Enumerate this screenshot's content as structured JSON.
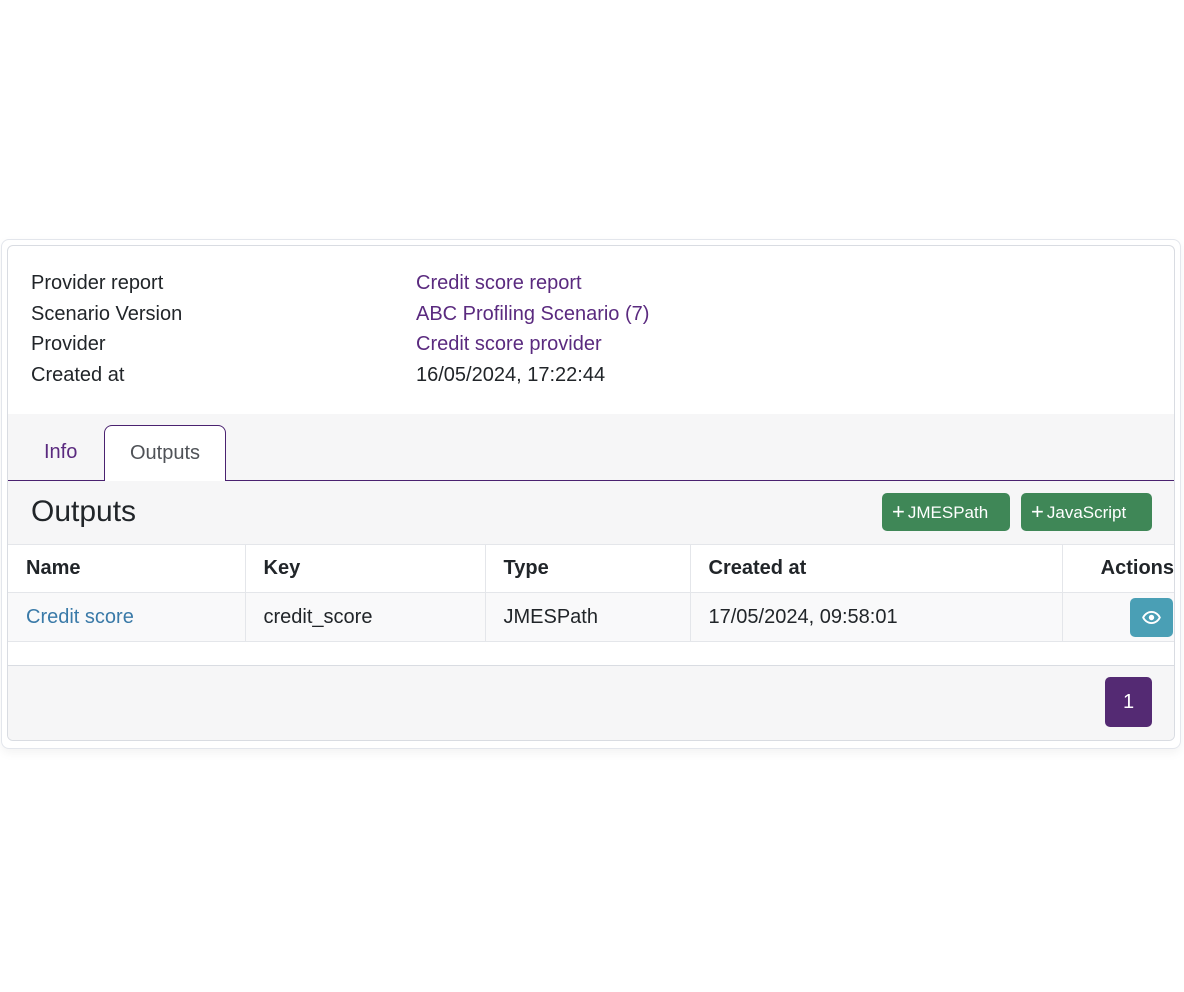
{
  "details": [
    {
      "label": "Provider report",
      "value": "Credit score report",
      "is_link": true
    },
    {
      "label": "Scenario Version",
      "value": "ABC Profiling Scenario (7)",
      "is_link": true
    },
    {
      "label": "Provider",
      "value": "Credit score provider",
      "is_link": true
    },
    {
      "label": "Created at",
      "value": "16/05/2024, 17:22:44",
      "is_link": false
    }
  ],
  "tabs": [
    {
      "label": "Info",
      "active": false
    },
    {
      "label": "Outputs",
      "active": true
    }
  ],
  "outputs": {
    "title": "Outputs",
    "add_jmespath_label": "JMESPath",
    "add_javascript_label": "JavaScript",
    "columns": [
      "Name",
      "Key",
      "Type",
      "Created at",
      "Actions"
    ],
    "rows": [
      {
        "name": "Credit score",
        "key": "credit_score",
        "type": "JMESPath",
        "created_at": "17/05/2024, 09:58:01",
        "action_icon": "eye-icon"
      }
    ]
  },
  "pagination": {
    "current_page": "1"
  },
  "colors": {
    "primary": "#542a73",
    "success": "#3f8757",
    "info": "#4a9fb5",
    "link": "#5a2a7f"
  }
}
